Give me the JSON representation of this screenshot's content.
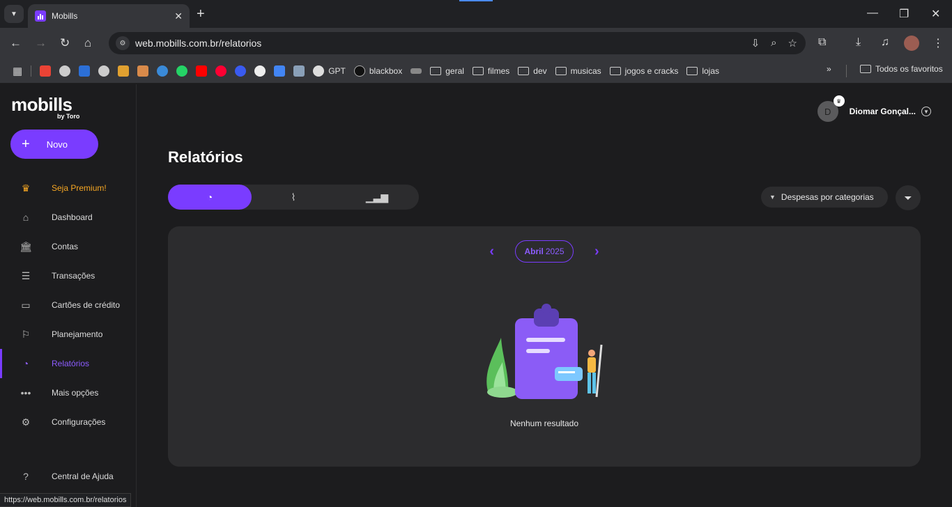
{
  "browser": {
    "tab_title": "Mobills",
    "url": "web.mobills.com.br/relatorios",
    "status_url": "https://web.mobills.com.br/relatorios",
    "bookmarks": [
      {
        "label": "GPT"
      },
      {
        "label": "blackbox"
      },
      {
        "label": "geral"
      },
      {
        "label": "filmes"
      },
      {
        "label": "dev"
      },
      {
        "label": "musicas"
      },
      {
        "label": "jogos e cracks"
      },
      {
        "label": "lojas"
      }
    ],
    "all_bookmarks": "Todos os favoritos"
  },
  "sidebar": {
    "logo": "mobills",
    "logo_sub": "by Toro",
    "new_button": "Novo",
    "items": [
      {
        "label": "Seja Premium!",
        "icon": "crown-icon"
      },
      {
        "label": "Dashboard",
        "icon": "home-icon"
      },
      {
        "label": "Contas",
        "icon": "bank-icon"
      },
      {
        "label": "Transações",
        "icon": "list-icon"
      },
      {
        "label": "Cartões de crédito",
        "icon": "card-icon"
      },
      {
        "label": "Planejamento",
        "icon": "flag-icon"
      },
      {
        "label": "Relatórios",
        "icon": "pie-icon"
      },
      {
        "label": "Mais opções",
        "icon": "dots-icon"
      },
      {
        "label": "Configurações",
        "icon": "gear-icon"
      },
      {
        "label": "Central de Ajuda",
        "icon": "help-icon"
      }
    ]
  },
  "header": {
    "user_initial": "D",
    "user_name": "Diomar Gonçal..."
  },
  "main": {
    "title": "Relatórios",
    "category_select": "Despesas por categorias",
    "month": "Abril",
    "year": "2025",
    "empty_text": "Nenhum resultado"
  },
  "colors": {
    "accent": "#7a3cff",
    "premium": "#f5a623",
    "background": "#1c1c1e",
    "card": "#2c2c2e"
  }
}
